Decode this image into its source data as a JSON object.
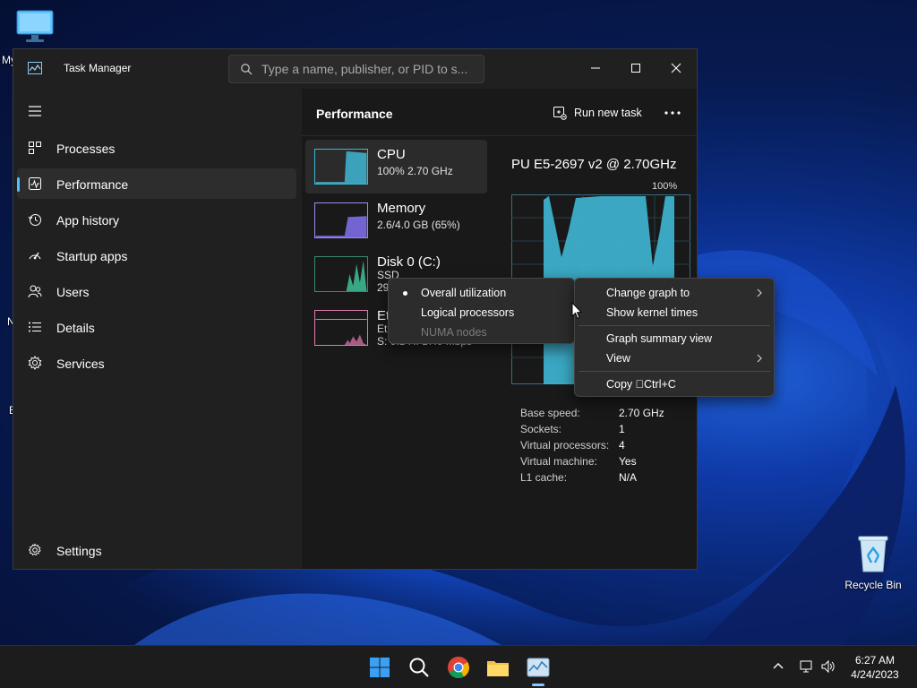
{
  "desktop": {
    "icons": [
      {
        "label": "Recycle Bin"
      }
    ],
    "edge_fragments": [
      "My",
      "N",
      "E"
    ]
  },
  "window": {
    "title": "Task Manager",
    "search": {
      "placeholder": "Type a name, publisher, or PID to s..."
    }
  },
  "sidebar": {
    "items": [
      {
        "label": "Processes",
        "icon": "processes-icon"
      },
      {
        "label": "Performance",
        "icon": "performance-icon",
        "active": true
      },
      {
        "label": "App history",
        "icon": "history-icon"
      },
      {
        "label": "Startup apps",
        "icon": "startup-icon"
      },
      {
        "label": "Users",
        "icon": "users-icon"
      },
      {
        "label": "Details",
        "icon": "details-icon"
      },
      {
        "label": "Services",
        "icon": "services-icon"
      }
    ],
    "settings_label": "Settings"
  },
  "main": {
    "title": "Performance",
    "run_task_label": "Run new task",
    "resources": [
      {
        "name": "CPU",
        "sub": [
          "100%  2.70 GHz"
        ],
        "color": "#3fb7d5",
        "selected": true
      },
      {
        "name": "Memory",
        "sub": [
          "2.6/4.0 GB (65%)"
        ],
        "color": "#9b8cf0"
      },
      {
        "name": "Disk 0 (C:)",
        "sub": [
          "SSD",
          "29"
        ],
        "color": "#3fbf9a"
      },
      {
        "name": "Et",
        "sub": [
          "Et",
          "S: 0.1  R: 17.0 Mbps"
        ],
        "color": "#e07ab0"
      }
    ],
    "detail": {
      "cpu_model": "PU E5-2697 v2 @ 2.70GHz",
      "max_label": "100%",
      "specs": [
        {
          "label": "Base speed:",
          "value": "2.70 GHz"
        },
        {
          "label": "Sockets:",
          "value": "1"
        },
        {
          "label": "Virtual processors:",
          "value": "4"
        },
        {
          "label": "Virtual machine:",
          "value": "Yes"
        },
        {
          "label": "L1 cache:",
          "value": "N/A"
        }
      ]
    }
  },
  "submenu": {
    "items": [
      {
        "label": "Overall utilization",
        "selected": true
      },
      {
        "label": "Logical processors"
      },
      {
        "label": "NUMA nodes",
        "disabled": true
      }
    ]
  },
  "context_menu": {
    "items": [
      {
        "label": "Change graph to",
        "submenu": true
      },
      {
        "label": "Show kernel times"
      },
      {
        "label": "Graph summary view"
      },
      {
        "label": "View",
        "submenu": true
      },
      {
        "label": "Copy \u0000Ctrl+C"
      }
    ]
  },
  "taskbar": {
    "time": "6:27 AM",
    "date": "4/24/2023",
    "apps": [
      "start-icon",
      "search-icon",
      "chrome-icon",
      "file-explorer-icon",
      "task-manager-icon"
    ]
  },
  "colors": {
    "accent": "#4cc2ff",
    "cpu_graph": "#3fb7d5",
    "window_bg": "#202020"
  }
}
